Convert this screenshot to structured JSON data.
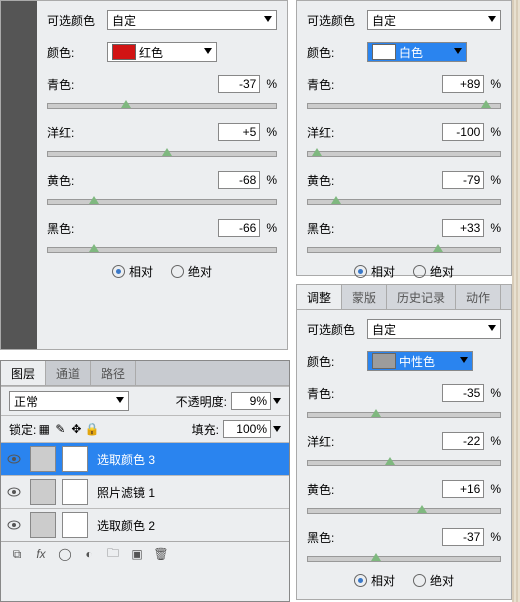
{
  "left": {
    "preset_label": "可选颜色",
    "preset_value": "自定",
    "color_label": "颜色:",
    "color_value": "红色",
    "swatch": "#d11414",
    "sliders": [
      {
        "name": "青色:",
        "v": "-37",
        "pos": 32
      },
      {
        "name": "洋红:",
        "v": "+5",
        "pos": 50
      },
      {
        "name": "黄色:",
        "v": "-68",
        "pos": 18
      },
      {
        "name": "黑色:",
        "v": "-66",
        "pos": 18
      }
    ],
    "radio": {
      "rel": "相对",
      "abs": "绝对"
    }
  },
  "topRight": {
    "preset_label": "可选颜色",
    "preset_value": "自定",
    "color_label": "颜色:",
    "color_value": "白色",
    "swatch": "#ffffff",
    "sliders": [
      {
        "name": "青色:",
        "v": "+89",
        "pos": 90
      },
      {
        "name": "洋红:",
        "v": "-100",
        "pos": 2
      },
      {
        "name": "黄色:",
        "v": "-79",
        "pos": 12
      },
      {
        "name": "黑色:",
        "v": "+33",
        "pos": 65
      }
    ],
    "radio": {
      "rel": "相对",
      "abs": "绝对"
    }
  },
  "botRight": {
    "tabs": [
      "调整",
      "蒙版",
      "历史记录",
      "动作"
    ],
    "preset_label": "可选颜色",
    "preset_value": "自定",
    "color_label": "颜色:",
    "color_value": "中性色",
    "swatch": "#9c9c9c",
    "sliders": [
      {
        "name": "青色:",
        "v": "-35",
        "pos": 33
      },
      {
        "name": "洋红:",
        "v": "-22",
        "pos": 40
      },
      {
        "name": "黄色:",
        "v": "+16",
        "pos": 57
      },
      {
        "name": "黑色:",
        "v": "-37",
        "pos": 33
      }
    ],
    "radio": {
      "rel": "相对",
      "abs": "绝对"
    }
  },
  "layers": {
    "tabs": [
      "图层",
      "通道",
      "路径"
    ],
    "blend": "正常",
    "opacity_label": "不透明度:",
    "opacity": "9%",
    "lock_label": "锁定:",
    "fill_label": "填充:",
    "fill": "100%",
    "items": [
      {
        "name": "选取颜色 3",
        "sel": true
      },
      {
        "name": "照片滤镜 1",
        "sel": false
      },
      {
        "name": "选取颜色 2",
        "sel": false
      }
    ]
  },
  "chart_data": {
    "type": "table",
    "title": "Photoshop Selective Color adjustment parameters",
    "series": [
      {
        "name": "红色(Red)",
        "values": {
          "青色": -37,
          "洋红": 5,
          "黄色": -68,
          "黑色": -66
        },
        "mode": "相对"
      },
      {
        "name": "白色(White)",
        "values": {
          "青色": 89,
          "洋红": -100,
          "黄色": -79,
          "黑色": 33
        },
        "mode": "相对"
      },
      {
        "name": "中性色(Neutral)",
        "values": {
          "青色": -35,
          "洋红": -22,
          "黄色": 16,
          "黑色": -37
        },
        "mode": "相对"
      }
    ]
  }
}
